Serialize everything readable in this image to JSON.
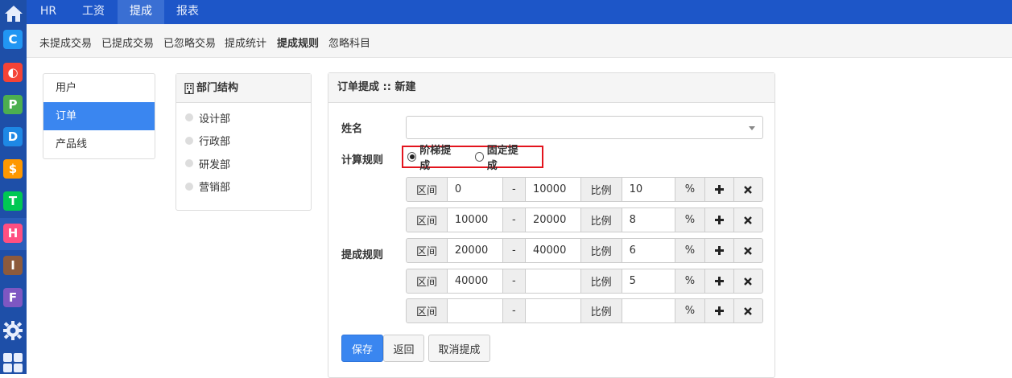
{
  "rail": {
    "apps": [
      {
        "icon": "c-app-icon",
        "letter": "C",
        "color": "#2196f3"
      },
      {
        "icon": "o-app-icon",
        "letter": "◐",
        "color": "#f44336"
      },
      {
        "icon": "p-app-icon",
        "letter": "P",
        "color": "#4caf50"
      },
      {
        "icon": "d-app-icon",
        "letter": "D",
        "color": "#1e88e5"
      },
      {
        "icon": "dollar-app-icon",
        "letter": "$",
        "color": "#ff9800"
      },
      {
        "icon": "t-app-icon",
        "letter": "T",
        "color": "#00c853"
      },
      {
        "icon": "h-app-icon",
        "letter": "H",
        "color": "#ff4f81"
      },
      {
        "icon": "i-app-icon",
        "letter": "I",
        "color": "#8d5a3c"
      },
      {
        "icon": "f-app-icon",
        "letter": "F",
        "color": "#7e57c2"
      }
    ]
  },
  "topnav": {
    "items": [
      "HR",
      "工资",
      "提成",
      "报表"
    ],
    "active": "提成"
  },
  "subnav": {
    "items": [
      "未提成交易",
      "已提成交易",
      "已忽略交易",
      "提成统计",
      "提成规则",
      "忽略科目"
    ],
    "active": "提成规则"
  },
  "leftmenu": {
    "items": [
      "用户",
      "订单",
      "产品线"
    ],
    "active": "订单"
  },
  "dept": {
    "title": "部门结构",
    "items": [
      "设计部",
      "行政部",
      "研发部",
      "营销部"
    ]
  },
  "form": {
    "title": "订单提成 :: 新建",
    "name_label": "姓名",
    "name_value": "",
    "calc_label": "计算规则",
    "radio_options": [
      "阶梯提成",
      "固定提成"
    ],
    "radio_selected": "阶梯提成",
    "rules_label": "提成规则",
    "range_label": "区间",
    "dash": "-",
    "ratio_label": "比例",
    "percent": "%",
    "rules": [
      {
        "from": "0",
        "to": "10000",
        "ratio": "10"
      },
      {
        "from": "10000",
        "to": "20000",
        "ratio": "8"
      },
      {
        "from": "20000",
        "to": "40000",
        "ratio": "6"
      },
      {
        "from": "40000",
        "to": "",
        "ratio": "5"
      },
      {
        "from": "",
        "to": "",
        "ratio": ""
      }
    ],
    "buttons": {
      "save": "保存",
      "back": "返回",
      "cancel": "取消提成"
    }
  },
  "colors": {
    "nav": "#1d56c8",
    "rail": "#1e4fa8",
    "primary": "#3a86f0",
    "highlight": "#e3141d"
  }
}
